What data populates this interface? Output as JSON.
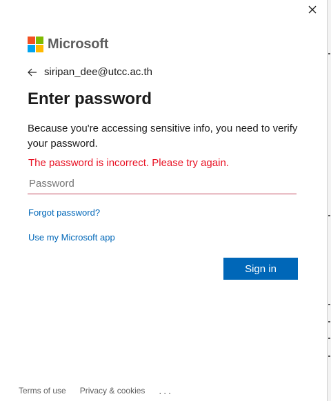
{
  "brand": {
    "name": "Microsoft",
    "logo_colors": [
      "#f25022",
      "#7fba00",
      "#00a4ef",
      "#ffb900"
    ]
  },
  "identity": {
    "back_icon": "arrow-left-icon",
    "email": "siripan_dee@utcc.ac.th"
  },
  "title": "Enter password",
  "description": "Because you're accessing sensitive info, you need to verify your password.",
  "error": "The password is incorrect. Please try again.",
  "password_field": {
    "placeholder": "Password",
    "value": ""
  },
  "links": {
    "forgot_password": "Forgot password?",
    "use_app": "Use my Microsoft app"
  },
  "sign_in_button": "Sign in",
  "footer": {
    "terms": "Terms of use",
    "privacy": "Privacy & cookies",
    "more": "..."
  },
  "close_icon": "close-icon",
  "colors": {
    "accent": "#0067b8",
    "error": "#e81123"
  }
}
